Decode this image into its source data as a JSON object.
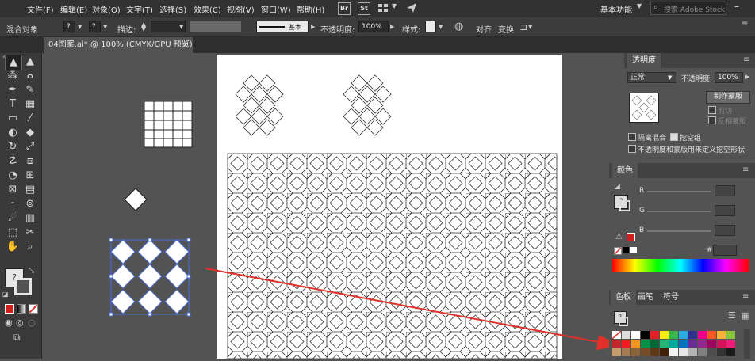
{
  "menubar": {
    "items": [
      "文件(F)",
      "编辑(E)",
      "对象(O)",
      "文字(T)",
      "选择(S)",
      "效果(C)",
      "视图(V)",
      "窗口(W)",
      "帮助(H)"
    ],
    "bridge": "Br",
    "stock": "St",
    "workspace": "基本功能",
    "search_placeholder": "搜索 Adobe Stock"
  },
  "controlbar": {
    "selection": "混合对象",
    "stroke_label": "描边:",
    "stroke_style": "基本",
    "opacity_label": "不透明度:",
    "opacity_value": "100%",
    "style_label": "样式:",
    "align_label": "对齐",
    "transform_label": "变换"
  },
  "document": {
    "tab_title": "04图案.ai* @ 100% (CMYK/GPU 预览)",
    "close": "×"
  },
  "transparency_panel": {
    "title": "透明度",
    "blend_mode": "正常",
    "opacity_label": "不透明度:",
    "opacity_value": "100%",
    "make_mask": "制作蒙版",
    "clip": "剪切",
    "invert_mask": "反相蒙版",
    "isolate_blend": "隔离混合",
    "knockout_group": "挖空组",
    "opacity_mask_define": "不透明度和蒙版用来定义挖空形状"
  },
  "color_panel": {
    "title": "颜色",
    "r_label": "R",
    "g_label": "G",
    "b_label": "B",
    "hash": "#"
  },
  "swatches_panel": {
    "tabs": [
      "色板",
      "画笔",
      "符号"
    ]
  },
  "colors": {
    "accent_red": "#d0201c",
    "selection_blue": "#4a6fd8",
    "annotation_red": "#e0302a"
  }
}
